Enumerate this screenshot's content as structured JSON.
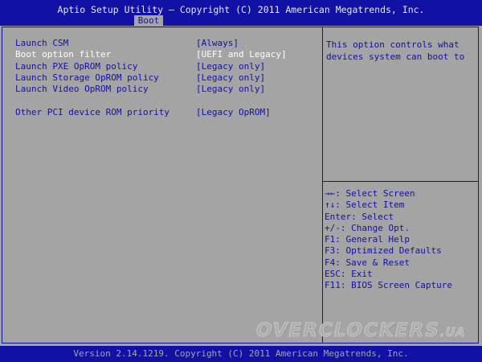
{
  "header": {
    "title": "Aptio Setup Utility – Copyright (C) 2011 American Megatrends, Inc.",
    "active_tab": "Boot"
  },
  "settings": [
    {
      "label": "Launch CSM",
      "value": "[Always]",
      "selected": false
    },
    {
      "label": "Boot option filter",
      "value": "[UEFI and Legacy]",
      "selected": true
    },
    {
      "label": "Launch PXE OpROM policy",
      "value": "[Legacy only]",
      "selected": false
    },
    {
      "label": "Launch Storage OpROM policy",
      "value": "[Legacy only]",
      "selected": false
    },
    {
      "label": "Launch Video OpROM policy",
      "value": "[Legacy only]",
      "selected": false
    },
    {
      "label": "Other PCI device ROM priority",
      "value": "[Legacy OpROM]",
      "selected": false
    }
  ],
  "help": {
    "text": "This option controls what devices system can boot to"
  },
  "keys": [
    "→←: Select Screen",
    "↑↓: Select Item",
    "Enter: Select",
    "+/-: Change Opt.",
    "F1: General Help",
    "F3: Optimized Defaults",
    "F4: Save & Reset",
    "ESC: Exit",
    "F11: BIOS Screen Capture"
  ],
  "watermark": {
    "main": "OVERCLOCKERS",
    "suffix": ".UA"
  },
  "footer": {
    "text": "Version 2.14.1219. Copyright (C) 2011 American Megatrends, Inc."
  },
  "colors": {
    "background": "#a4a4a4",
    "bar_blue": "#1111a6",
    "selected_text": "#ffffff"
  }
}
